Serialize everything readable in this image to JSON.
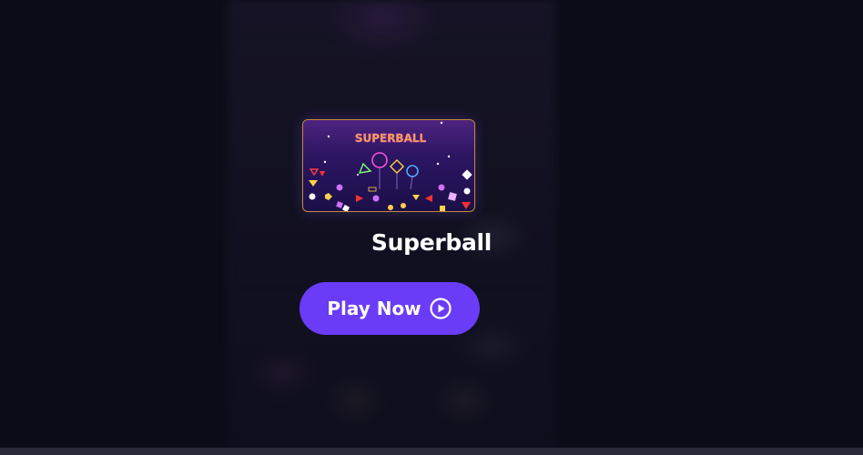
{
  "game": {
    "title": "Superball",
    "thumbnail_text": "SUPERBALL"
  },
  "cta": {
    "label": "Play Now",
    "icon": "play-circle-icon",
    "color": "#6a3cf7"
  },
  "colors": {
    "background": "#0c0c19",
    "thumbnail_border": "#c48a3a"
  }
}
